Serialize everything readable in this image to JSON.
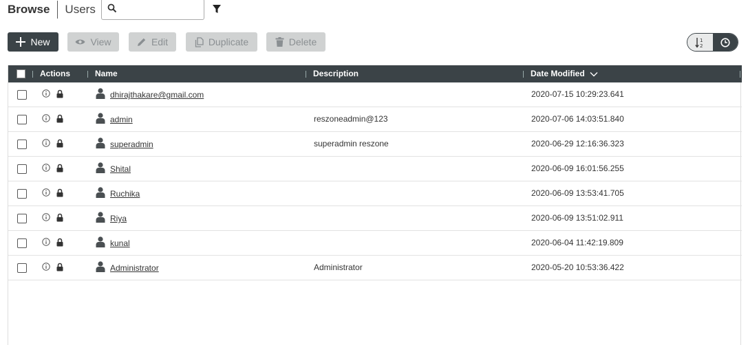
{
  "header": {
    "breadcrumb_root": "Browse",
    "breadcrumb_current": "Users",
    "search": {
      "value": "",
      "placeholder": ""
    }
  },
  "toolbar": {
    "new_label": "New",
    "view_label": "View",
    "edit_label": "Edit",
    "duplicate_label": "Duplicate",
    "delete_label": "Delete"
  },
  "sort_toggle": {
    "options": [
      "alphabetical",
      "date"
    ],
    "selected": "date"
  },
  "table": {
    "columns": {
      "actions": "Actions",
      "name": "Name",
      "description": "Description",
      "date_modified": "Date Modified"
    },
    "sort": {
      "column": "date_modified",
      "direction": "descending"
    },
    "rows": [
      {
        "name": "dhirajthakare@gmail.com",
        "description": "",
        "date": "2020-07-15 10:29:23.641"
      },
      {
        "name": "admin",
        "description": "reszoneadmin@123",
        "date": "2020-07-06 14:03:51.840"
      },
      {
        "name": "superadmin",
        "description": "superadmin reszone",
        "date": "2020-06-29 12:16:36.323"
      },
      {
        "name": "Shital",
        "description": "",
        "date": "2020-06-09 16:01:56.255"
      },
      {
        "name": "Ruchika",
        "description": "",
        "date": "2020-06-09 13:53:41.705"
      },
      {
        "name": "Riya",
        "description": "",
        "date": "2020-06-09 13:51:02.911"
      },
      {
        "name": "kunal",
        "description": "",
        "date": "2020-06-04 11:42:19.809"
      },
      {
        "name": "Administrator",
        "description": "Administrator",
        "date": "2020-05-20 10:53:36.422"
      }
    ]
  },
  "colors": {
    "header_dark": "#3b4347",
    "disabled_bg": "#d0d2d2",
    "disabled_text": "#8a8f92"
  },
  "icons": {
    "search": "search-icon",
    "filter": "filter-icon",
    "new": "plus-icon",
    "view": "eye-icon",
    "edit": "pencil-icon",
    "duplicate": "duplicate-icon",
    "delete": "trash-icon",
    "row_info": "info-icon",
    "row_lock": "lock-icon",
    "row_user": "user-icon",
    "sort_alpha": "sort-alpha-icon",
    "sort_time": "clock-icon",
    "sort_dir": "chevron-down-icon"
  }
}
